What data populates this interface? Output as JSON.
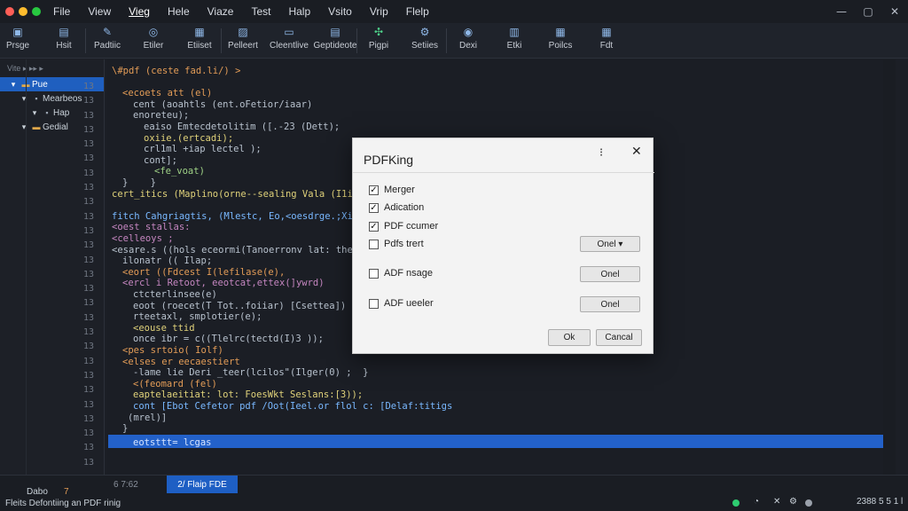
{
  "window": {
    "traffic_lights": [
      "#ff5f57",
      "#febc2e",
      "#28c840"
    ],
    "menu": [
      "File",
      "View",
      "Vieg",
      "Hele",
      "Viaze",
      "Test",
      "Halp",
      "Vsito",
      "Vrip",
      "Flelp"
    ],
    "active_menu_index": 2,
    "controls": [
      "—",
      "▢",
      "✕"
    ]
  },
  "toolbar": {
    "buttons": [
      {
        "label": "Prsge",
        "icon": "save-icon"
      },
      {
        "label": "Hsit",
        "icon": "file-icon"
      },
      {
        "label": "Padtiic",
        "icon": "pencil-icon"
      },
      {
        "label": "Etiler",
        "icon": "compass-icon"
      },
      {
        "label": "Etiiset",
        "icon": "document-icon"
      },
      {
        "label": "Pelleert",
        "icon": "image-icon"
      },
      {
        "label": "Cleentlive",
        "icon": "folder-icon"
      },
      {
        "label": "Geptideote",
        "icon": "file-doc-icon"
      },
      {
        "label": "Pigpi",
        "icon": "puzzle-icon"
      },
      {
        "label": "Setiies",
        "icon": "gear-icon"
      },
      {
        "label": "Dexi",
        "icon": "target-icon"
      },
      {
        "label": "Etki",
        "icon": "clipboard-icon"
      },
      {
        "label": "Poilcs",
        "icon": "grid-icon"
      },
      {
        "label": "Fdt",
        "icon": "calendar-icon"
      }
    ]
  },
  "sidebar": {
    "header": "Vite ▸ ▸▸ ▸",
    "tree": [
      {
        "label": "Pue",
        "selected": true,
        "indent": 0,
        "icon": "folder-icon"
      },
      {
        "label": "Mearbeos",
        "selected": false,
        "indent": 1,
        "icon": "file-icon"
      },
      {
        "label": "Hap",
        "selected": false,
        "indent": 2,
        "icon": "file-icon"
      },
      {
        "label": "Gedial",
        "selected": false,
        "indent": 1,
        "icon": "folder-icon"
      }
    ],
    "line_numbers": [
      "13",
      "13",
      "13",
      "13",
      "13",
      "13",
      "13",
      "13",
      "13",
      "13",
      "13",
      "13",
      "13",
      "13",
      "13",
      "13",
      "13",
      "13",
      "13",
      "13",
      "13",
      "13",
      "13",
      "13",
      "13",
      "13",
      "13"
    ]
  },
  "editor": {
    "lines": [
      {
        "indent": 0,
        "cls": "k",
        "text": "\\#pdf (ceste fad.li/) >"
      },
      {
        "indent": 0,
        "cls": "s",
        "text": ""
      },
      {
        "indent": 2,
        "cls": "k",
        "text": "<ecoets att (el)"
      },
      {
        "indent": 4,
        "cls": "s",
        "text": "cent (aoahtls (ent.oFetior/iaar)"
      },
      {
        "indent": 4,
        "cls": "s",
        "text": "enoreteu);"
      },
      {
        "indent": 6,
        "cls": "s",
        "text": "eaiso Emtecdetolitim ([.-23 (Dett);"
      },
      {
        "indent": 6,
        "cls": "f",
        "text": "oxiie.(ertcadi);"
      },
      {
        "indent": 6,
        "cls": "s",
        "text": "crl1ml +iap lectel );"
      },
      {
        "indent": 6,
        "cls": "s",
        "text": "cont];"
      },
      {
        "indent": 8,
        "cls": "g",
        "text": "<fe_voat)"
      },
      {
        "indent": 2,
        "cls": "s",
        "text": "}    }"
      },
      {
        "indent": 0,
        "cls": "f",
        "text": "cert_itics (Maplino(orne--sealing Vala (I1i"
      },
      {
        "indent": 0,
        "cls": "s",
        "text": ""
      },
      {
        "indent": 0,
        "cls": "b",
        "text": "fitch Cahgriagtis, (Mlestc, Eo,<oesdrge.;Xi"
      },
      {
        "indent": 0,
        "cls": "p",
        "text": "<oest stallas:"
      },
      {
        "indent": 0,
        "cls": "p",
        "text": "<celleoys ;"
      },
      {
        "indent": 0,
        "cls": "s",
        "text": "<esare.s ((hols eceormi(Tanoerronv lat: the la"
      },
      {
        "indent": 2,
        "cls": "s",
        "text": "ilonatr (( Ilap;"
      },
      {
        "indent": 2,
        "cls": "k",
        "text": "<eort ((Fdcest I(lefilase(e),"
      },
      {
        "indent": 2,
        "cls": "p",
        "text": "<ercl i Retoot, eeotcat,ettex(]ywrd)"
      },
      {
        "indent": 4,
        "cls": "s",
        "text": "ctcterlinsee(e)"
      },
      {
        "indent": 4,
        "cls": "s",
        "text": "eoot (roecet(T Tot..foiiar) [Csettea])"
      },
      {
        "indent": 4,
        "cls": "s",
        "text": "rteetaxl, smplotier(e);"
      },
      {
        "indent": 4,
        "cls": "f",
        "text": "<eouse ttid"
      },
      {
        "indent": 4,
        "cls": "s",
        "text": "once ibr = c((Tlelrc(tectd(I)3 ));"
      },
      {
        "indent": 2,
        "cls": "k",
        "text": "<pes srtoio( Iolf)"
      },
      {
        "indent": 2,
        "cls": "k",
        "text": "<elses er eecaestiert"
      },
      {
        "indent": 4,
        "cls": "s",
        "text": "-lame lie Deri _teer(lcilos\"(Ilger(0) ;  }"
      },
      {
        "indent": 4,
        "cls": "k",
        "text": "<(feomard (fel)"
      },
      {
        "indent": 4,
        "cls": "f",
        "text": "eaptelaeitiat: lot: FoesWkt Seslans:[3));"
      },
      {
        "indent": 4,
        "cls": "b",
        "text": "cont [Ebot Cefetor pdf /Oot(Ieel.or flol c: [Delaf:titigs"
      },
      {
        "indent": 3,
        "cls": "s",
        "text": "(mrel)]"
      },
      {
        "indent": 2,
        "cls": "s",
        "text": "}"
      },
      {
        "indent": 0,
        "cls": "s",
        "text": ""
      },
      {
        "indent": 4,
        "cls": "s",
        "text": "eotsttt= lcgas"
      }
    ]
  },
  "dialog": {
    "title": "PDFKing",
    "info_glyph": "⁝",
    "close_glyph": "✕",
    "checks": [
      {
        "label": "Merger",
        "checked": true
      },
      {
        "label": "Adication",
        "checked": true
      },
      {
        "label": "PDF ccumer",
        "checked": true
      },
      {
        "label": "Pdfs trert",
        "checked": false
      },
      {
        "label": "ADF nsage",
        "checked": false
      },
      {
        "label": "ADF ueeler",
        "checked": false
      }
    ],
    "side_buttons": [
      "Onel ▾",
      "Onel",
      "Onel"
    ],
    "ok_label": "Ok",
    "cancel_label": "Cancal"
  },
  "status": {
    "left_top": "Dabo",
    "left_top_badge": "7",
    "left_bottom": "Fleits Defontiing an PDF rinig",
    "counter": "6 7:62",
    "tab_label": "2/ Flaip FDE",
    "right_text": "2388 5 5 1 l",
    "right_dot_colors": [
      "#2ecc71",
      "#9aa1ab"
    ],
    "right_glyphs": [
      "◔",
      "✕",
      "⚙"
    ]
  }
}
